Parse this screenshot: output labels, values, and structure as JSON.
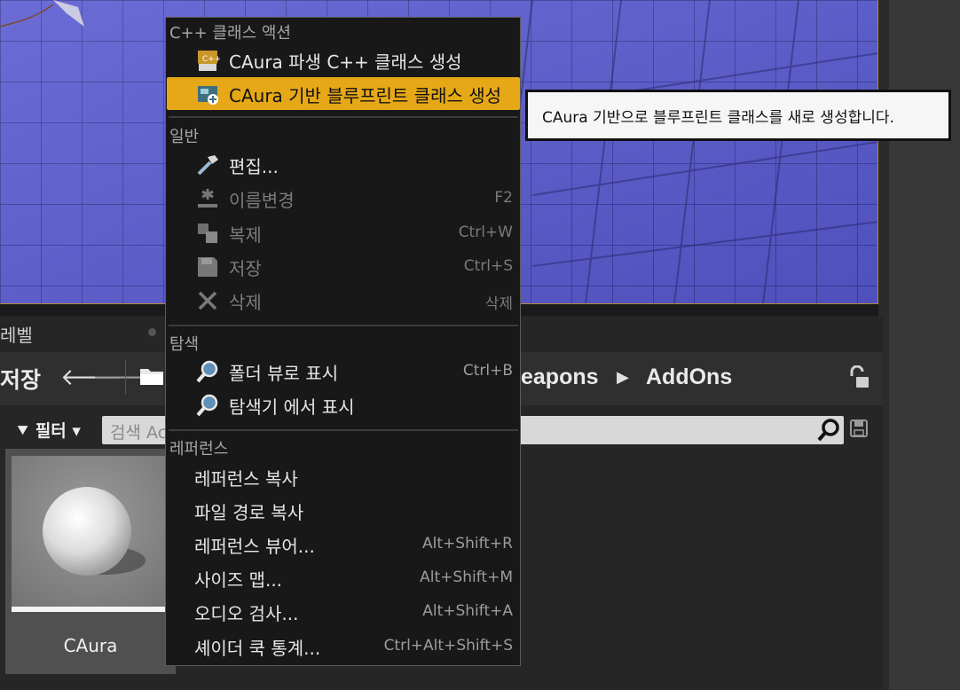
{
  "viewport": {},
  "content_browser": {
    "tab_label": "레벨",
    "save_label": "저장",
    "breadcrumbs": [
      "eapons",
      "AddOns"
    ],
    "filter_label": "필터",
    "search_placeholder": "검색 Ac",
    "asset": {
      "name": "CAura"
    }
  },
  "menu": {
    "sections": {
      "cpp": "C++ 클래스 액션",
      "general": "일반",
      "explore": "탐색",
      "references": "레퍼런스"
    },
    "items": {
      "derived_cpp": {
        "label": "CAura 파생 C++ 클래스 생성"
      },
      "blueprint": {
        "label": "CAura 기반 블루프린트 클래스 생성"
      },
      "edit": {
        "label": "편집..."
      },
      "rename": {
        "label": "이름변경",
        "shortcut": "F2"
      },
      "duplicate": {
        "label": "복제",
        "shortcut": "Ctrl+W"
      },
      "save": {
        "label": "저장",
        "shortcut": "Ctrl+S"
      },
      "delete": {
        "label": "삭제",
        "shortcut": "삭제"
      },
      "folder_view": {
        "label": "폴더 뷰로 표시",
        "shortcut": "Ctrl+B"
      },
      "explorer": {
        "label": "탐색기 에서 표시"
      },
      "copy_ref": {
        "label": "레퍼런스 복사"
      },
      "copy_path": {
        "label": "파일 경로 복사"
      },
      "ref_viewer": {
        "label": "레퍼런스 뷰어...",
        "shortcut": "Alt+Shift+R"
      },
      "size_map": {
        "label": "사이즈 맵...",
        "shortcut": "Alt+Shift+M"
      },
      "audit": {
        "label": "오디오 검사...",
        "shortcut": "Alt+Shift+A"
      },
      "shader_cook": {
        "label": "셰이더 쿡 통계...",
        "shortcut": "Ctrl+Alt+Shift+S"
      }
    }
  },
  "tooltip": {
    "text": "CAura 기반으로 블루프린트 클래스를 새로 생성합니다."
  },
  "colors": {
    "highlight": "#e6a817",
    "menu_bg": "#181818",
    "viewport_floor": "#5a5bd0"
  }
}
